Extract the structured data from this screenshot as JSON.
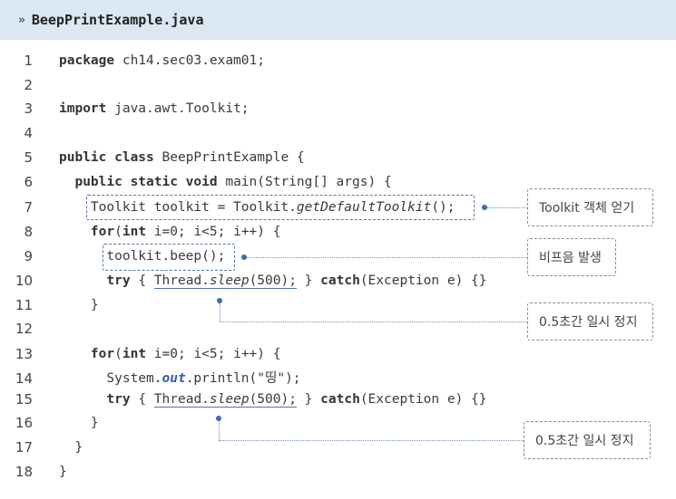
{
  "file": {
    "prefix": "»",
    "name": "BeepPrintExample.java"
  },
  "lines": [
    {
      "num": "1",
      "parts": [
        {
          "t": "package",
          "c": "kw"
        },
        {
          "t": " ch14.sec03.exam01;"
        }
      ]
    },
    {
      "num": "2",
      "parts": []
    },
    {
      "num": "3",
      "parts": [
        {
          "t": "import",
          "c": "kw"
        },
        {
          "t": " java.awt.Toolkit;"
        }
      ]
    },
    {
      "num": "4",
      "parts": []
    },
    {
      "num": "5",
      "parts": [
        {
          "t": "public class",
          "c": "kw"
        },
        {
          "t": " BeepPrintExample {"
        }
      ]
    },
    {
      "num": "6",
      "parts": [
        {
          "t": "  "
        },
        {
          "t": "public static void",
          "c": "kw"
        },
        {
          "t": " main(String[] args) {"
        }
      ]
    },
    {
      "num": "7",
      "parts": [
        {
          "t": "    Toolkit toolkit = Toolkit."
        },
        {
          "t": "getDefaultToolkit",
          "c": "it"
        },
        {
          "t": "();"
        }
      ]
    },
    {
      "num": "8",
      "parts": [
        {
          "t": "    "
        },
        {
          "t": "for",
          "c": "kw"
        },
        {
          "t": "("
        },
        {
          "t": "int",
          "c": "kw"
        },
        {
          "t": " i=0; i<5; i++) {"
        }
      ]
    },
    {
      "num": "9",
      "parts": [
        {
          "t": "      toolkit.beep();"
        }
      ]
    },
    {
      "num": "10",
      "parts": [
        {
          "t": "      "
        },
        {
          "t": "try",
          "c": "kw"
        },
        {
          "t": " { "
        },
        {
          "t": "Thread.",
          "c": "ul"
        },
        {
          "t": "sleep",
          "c": "it ul"
        },
        {
          "t": "(500);",
          "c": "ul"
        },
        {
          "t": " } "
        },
        {
          "t": "catch",
          "c": "kw"
        },
        {
          "t": "(Exception e) {}"
        }
      ]
    },
    {
      "num": "11",
      "parts": [
        {
          "t": "    }"
        }
      ]
    },
    {
      "num": "12",
      "parts": []
    },
    {
      "num": "13",
      "parts": [
        {
          "t": "    "
        },
        {
          "t": "for",
          "c": "kw"
        },
        {
          "t": "("
        },
        {
          "t": "int",
          "c": "kw"
        },
        {
          "t": " i=0; i<5; i++) {"
        }
      ]
    },
    {
      "num": "14",
      "parts": [
        {
          "t": "      System."
        },
        {
          "t": "out",
          "c": "itb"
        },
        {
          "t": ".println(\"띵\");"
        }
      ]
    },
    {
      "num": "15",
      "parts": [
        {
          "t": "      "
        },
        {
          "t": "try",
          "c": "kw"
        },
        {
          "t": " { "
        },
        {
          "t": "Thread.",
          "c": "ul"
        },
        {
          "t": "sleep",
          "c": "it ul"
        },
        {
          "t": "(500);",
          "c": "ul"
        },
        {
          "t": " } "
        },
        {
          "t": "catch",
          "c": "kw"
        },
        {
          "t": "(Exception e) {}"
        }
      ]
    },
    {
      "num": "16",
      "parts": [
        {
          "t": "    }"
        }
      ]
    },
    {
      "num": "17",
      "parts": [
        {
          "t": "  }"
        }
      ]
    },
    {
      "num": "18",
      "parts": [
        {
          "t": "}"
        }
      ]
    }
  ],
  "callouts": {
    "toolkit": "Toolkit 객체 얻기",
    "beep": "비프음 발생",
    "sleep1": "0.5초간 일시 정지",
    "sleep2": "0.5초간 일시 정지"
  }
}
